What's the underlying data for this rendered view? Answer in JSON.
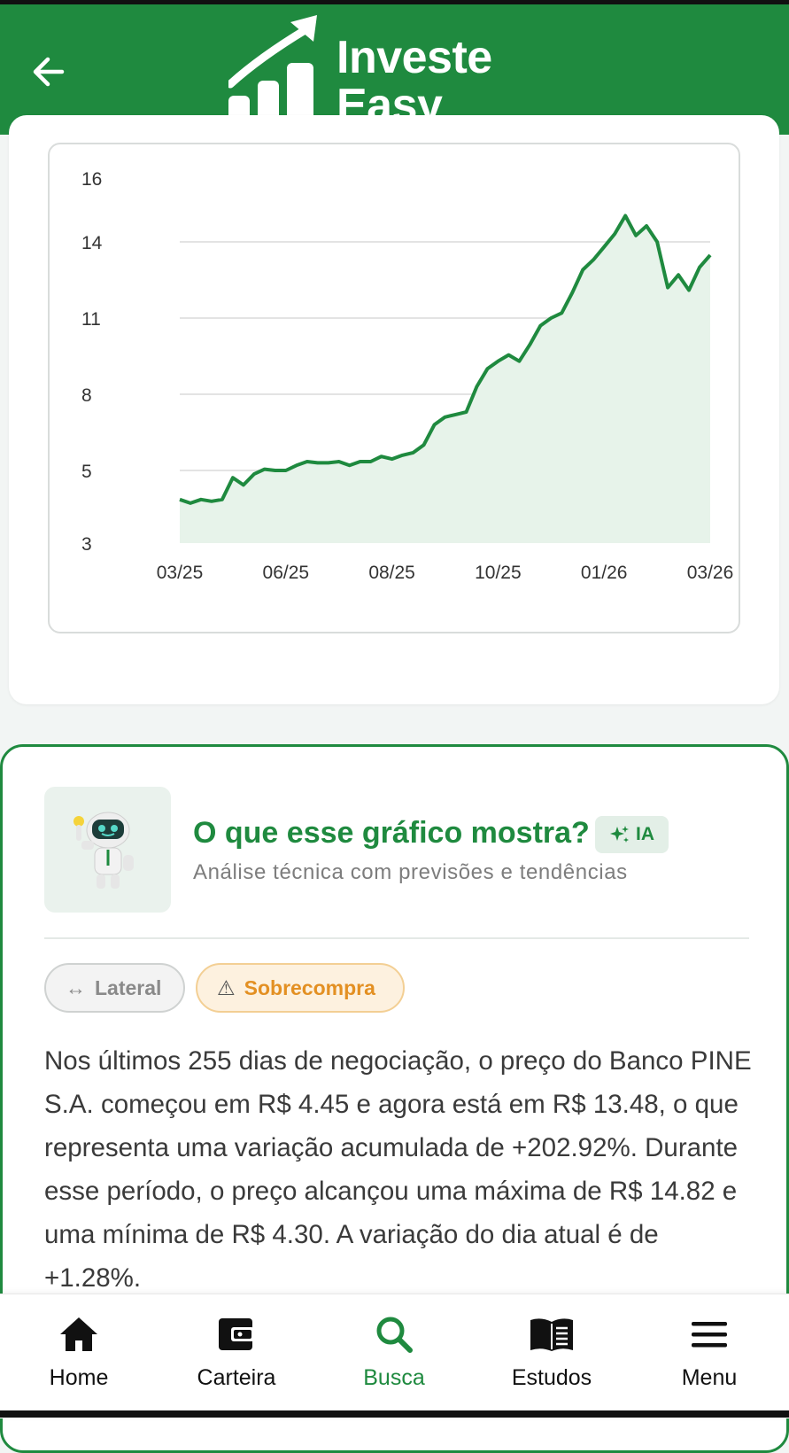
{
  "header": {
    "back_icon": "arrow-left-icon",
    "logo_line1": "Investe",
    "logo_line2": "Easy",
    "color": "#1f8a3f"
  },
  "chart_data": {
    "type": "area",
    "y_ticks": [
      16,
      14,
      11,
      8,
      5,
      3
    ],
    "x_ticks": [
      "03/25",
      "06/25",
      "08/25",
      "10/25",
      "01/26",
      "03/26"
    ],
    "ylim": [
      3,
      16
    ],
    "grid": true,
    "line_color": "#1f8a3f",
    "fill_color": "#e7f3ea",
    "series": [
      {
        "x": [
          0,
          2,
          4,
          6,
          8,
          10,
          12,
          14,
          16,
          18,
          20,
          22,
          24,
          26,
          28,
          30,
          32,
          34,
          36,
          38,
          40,
          42,
          44,
          46,
          48,
          50,
          52,
          54,
          56,
          58,
          60,
          62,
          64,
          66,
          68,
          70,
          72,
          74,
          76,
          78,
          80,
          82,
          84,
          86,
          88,
          90,
          92,
          94,
          96,
          98,
          100
        ],
        "values": [
          4.2,
          4.1,
          4.2,
          4.15,
          4.2,
          4.8,
          4.6,
          4.9,
          5.05,
          5.0,
          5.0,
          5.2,
          5.35,
          5.3,
          5.3,
          5.35,
          5.2,
          5.35,
          5.35,
          5.55,
          5.45,
          5.6,
          5.7,
          6.0,
          6.8,
          7.1,
          7.2,
          7.3,
          8.3,
          9.0,
          9.3,
          9.55,
          9.3,
          9.95,
          10.7,
          11.0,
          11.2,
          12.0,
          12.9,
          13.3,
          13.8,
          14.25,
          14.82,
          14.2,
          14.5,
          14.0,
          12.2,
          12.7,
          12.1,
          13.0,
          13.48
        ]
      }
    ]
  },
  "analysis": {
    "robot_icon": "robot-mascot-icon",
    "title": "O que esse gráfico mostra?",
    "badge_label": "IA",
    "badge_icon": "sparkle-icon",
    "subtitle": "Análise técnica com previsões e tendências",
    "chips": [
      {
        "icon_text": "↔",
        "label": "Lateral"
      },
      {
        "icon_text": "⚠",
        "label": "Sobrecompra"
      }
    ],
    "body": "Nos últimos 255 dias de negociação, o preço do Banco PINE S.A. começou em R$ 4.45 e agora está em R$ 13.48, o que representa uma variação acumulada de +202.92%. Durante esse período, o preço alcançou uma máxima de R$ 14.82 e uma mínima de R$ 4.30. A variação do dia atual é de +1.28%."
  },
  "tabbar": [
    {
      "label": "Home",
      "icon": "home-icon"
    },
    {
      "label": "Carteira",
      "icon": "wallet-icon"
    },
    {
      "label": "Busca",
      "icon": "search-icon",
      "active": true
    },
    {
      "label": "Estudos",
      "icon": "book-icon"
    },
    {
      "label": "Menu",
      "icon": "menu-icon"
    }
  ]
}
